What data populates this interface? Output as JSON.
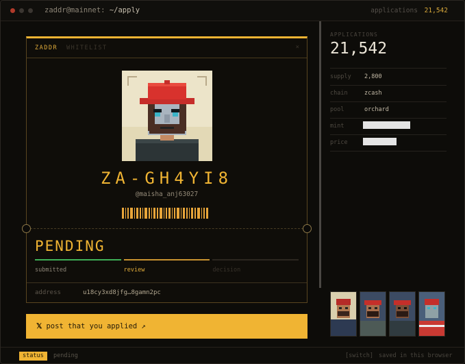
{
  "window": {
    "user_host": "zaddr@mainnet:",
    "path": "~/apply",
    "counter_label": "applications",
    "counter_value": "21,542"
  },
  "card": {
    "tabs": [
      "ZADDR",
      "WHITELIST"
    ],
    "close_glyph": "×",
    "code": "ZA-GH4YI8",
    "handle": "@maisha_anj63027",
    "status": "PENDING",
    "steps": [
      {
        "label": "submitted",
        "state": "done"
      },
      {
        "label": "review",
        "state": "active"
      },
      {
        "label": "decision",
        "state": "pending"
      }
    ],
    "address_label": "address",
    "address_value": "u18cy3xd8jfg…8gamn2pc"
  },
  "post_button": {
    "icon": "x-logo-icon",
    "icon_glyph": "𝕏",
    "label": "post that you applied",
    "arrow": "↗"
  },
  "panel": {
    "label": "APPLICATIONS",
    "total": "21,542",
    "rows": [
      {
        "key": "supply",
        "value": "2,800"
      },
      {
        "key": "chain",
        "value": "zcash"
      },
      {
        "key": "pool",
        "value": "orchard"
      },
      {
        "key": "mint",
        "value": ""
      },
      {
        "key": "price",
        "value": ""
      }
    ]
  },
  "statusbar": {
    "badge": "status",
    "text": "pending",
    "switch": "[switch]",
    "saved": "saved in this browser"
  },
  "colors": {
    "accent": "#f0b433",
    "success": "#3fb157",
    "background": "#0d0c09"
  }
}
